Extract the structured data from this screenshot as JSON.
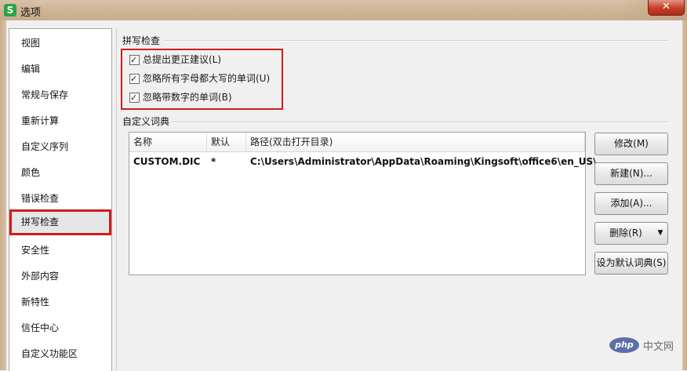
{
  "window": {
    "app_icon_letter": "S",
    "title": "选项",
    "close_glyph": "✕"
  },
  "nav": {
    "items": [
      {
        "label": "视图"
      },
      {
        "label": "编辑"
      },
      {
        "label": "常规与保存"
      },
      {
        "label": "重新计算"
      },
      {
        "label": "自定义序列"
      },
      {
        "label": "颜色"
      },
      {
        "label": "错误检查"
      },
      {
        "label": "拼写检查",
        "selected": true
      },
      {
        "label": "安全性"
      },
      {
        "label": "外部内容"
      },
      {
        "label": "新特性"
      },
      {
        "label": "信任中心"
      },
      {
        "label": "自定义功能区"
      }
    ]
  },
  "spell_check": {
    "group_title": "拼写检查",
    "options": [
      {
        "label": "总提出更正建议(L)",
        "checked": true
      },
      {
        "label": "忽略所有字母都大写的单词(U)",
        "checked": true
      },
      {
        "label": "忽略带数字的单词(B)",
        "checked": true
      }
    ]
  },
  "custom_dict": {
    "group_title": "自定义词典",
    "columns": [
      "名称",
      "默认",
      "路径(双击打开目录)"
    ],
    "rows": [
      {
        "name": "CUSTOM.DIC",
        "default": "*",
        "path": "C:\\Users\\Administrator\\AppData\\Roaming\\Kingsoft\\office6\\en_US\\"
      }
    ]
  },
  "buttons": {
    "modify": "修改(M)",
    "new": "新建(N)...",
    "add": "添加(A)...",
    "delete": "删除(R)",
    "delete_arrow": "▼",
    "set_default": "设为默认词典(S)"
  },
  "watermark": {
    "logo": "php",
    "text": "中文网"
  },
  "colors": {
    "highlight_red": "#d01c1c",
    "title_bar": "#cdb294",
    "close_button": "#c7402c",
    "app_icon_green": "#2ba245"
  }
}
